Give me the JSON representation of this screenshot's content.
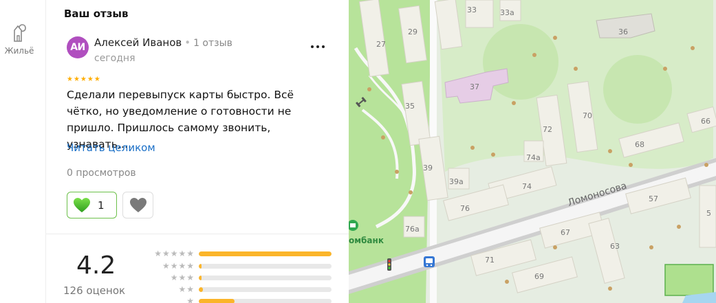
{
  "rail": {
    "item_label": "Жильё"
  },
  "review": {
    "section_title": "Ваш отзыв",
    "avatar_initials": "АИ",
    "author_name": "Алексей Иванов",
    "author_reviews": "1 отзыв",
    "date": "сегодня",
    "stars": "★★★★★",
    "text": "Сделали перевыпуск карты быстро. Всё чётко, но уведомление о готовности не пришло. Пришлось самому звонить, узнавать,…",
    "read_more": "Читать целиком",
    "views": "0 просмотров",
    "like_count": "1"
  },
  "rating": {
    "value": "4.2",
    "count": "126 оценок",
    "distribution": [
      {
        "stars": "★★★★★",
        "fraction": 1.0
      },
      {
        "stars": "★★★★",
        "fraction": 0.02
      },
      {
        "stars": "★★★",
        "fraction": 0.02
      },
      {
        "stars": "★★",
        "fraction": 0.03
      },
      {
        "stars": "★",
        "fraction": 0.27
      }
    ]
  },
  "map": {
    "street": "Ломоносова",
    "poi_label": "омбанк",
    "buildings": [
      "33",
      "33а",
      "29",
      "27",
      "36",
      "37",
      "35",
      "70",
      "72",
      "66",
      "68",
      "74а",
      "39",
      "39а",
      "74",
      "76",
      "57",
      "76а",
      "67",
      "63",
      "71",
      "69",
      "5"
    ]
  },
  "colors": {
    "accent_link": "#1a6fc7",
    "star": "#ffae00",
    "bar": "#fbb52a",
    "like_border": "#6cc04a",
    "avatar": "#b04fbf"
  }
}
